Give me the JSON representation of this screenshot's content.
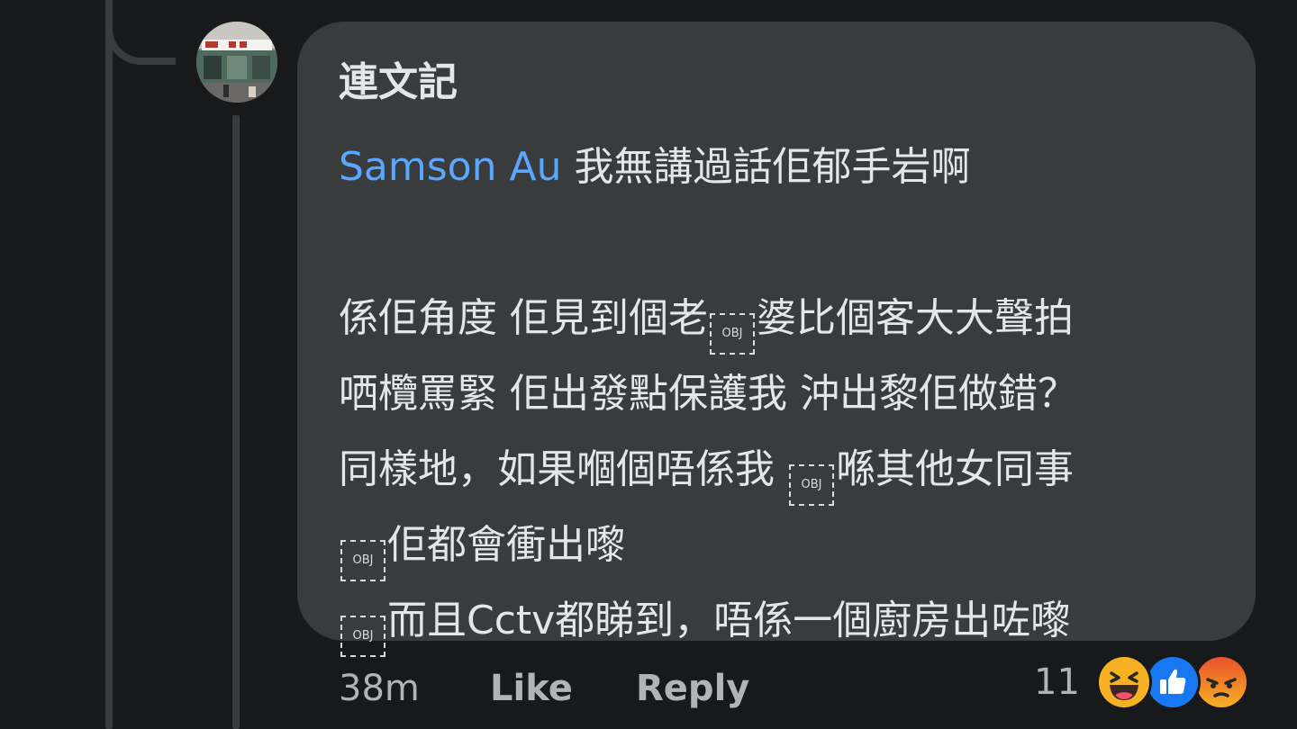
{
  "comment": {
    "author": "連文記",
    "mention": "Samson Au",
    "line1_rest": " 我無講過話佢郁手岩啊",
    "obj_label": "OBJ",
    "p2_l1a": "係佢角度 佢見到個老",
    "p2_l1b": "婆比個客大大聲拍",
    "p2_l2": "哂欖罵緊 佢出發點保護我 沖出黎佢做錯？",
    "p2_l3a": "同樣地，如果嗰個唔係我 ",
    "p2_l3b": "喺其他女同事",
    "p2_l4": "佢都會衝出嚟",
    "p2_l5": "而且Cctv都睇到，唔係一個廚房出咗嚟"
  },
  "actions": {
    "time": "38m",
    "like_label": "Like",
    "reply_label": "Reply",
    "reaction_count": "11"
  },
  "reactions": [
    "haha-icon",
    "like-icon",
    "angry-icon"
  ],
  "colors": {
    "background": "#18191a",
    "bubble": "#3a3b3c",
    "mention": "#5aa7ff",
    "text": "#e4e6eb",
    "muted": "#b0b3b8"
  }
}
